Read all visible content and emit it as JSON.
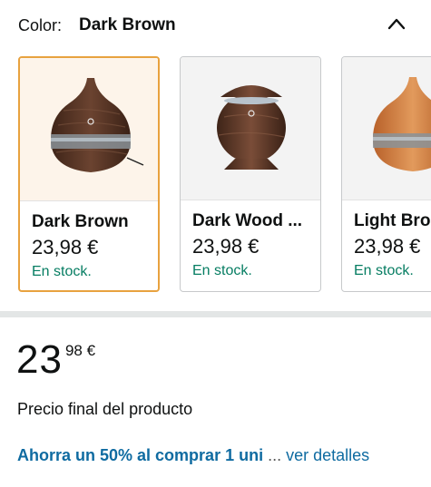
{
  "color_selector": {
    "label": "Color:",
    "selected_value": "Dark Brown",
    "toggle_icon": "chevron-up-icon"
  },
  "variants": [
    {
      "name": "Dark Brown",
      "price": "23,98 €",
      "stock": "En stock.",
      "selected": true
    },
    {
      "name": "Dark Wood ...",
      "price": "23,98 €",
      "stock": "En stock.",
      "selected": false
    },
    {
      "name": "Light Bro",
      "price": "23,98 €",
      "stock": "En stock.",
      "selected": false
    }
  ],
  "price": {
    "whole": "23",
    "fraction": "98",
    "currency": "€",
    "final_label": "Precio final del producto"
  },
  "promo": {
    "offer_text": "Ahorra un 50% al comprar 1 uni",
    "ellipsis": "...",
    "details_link": "ver detalles"
  },
  "colors": {
    "selected_border": "#e8a23f",
    "stock_green": "#067d62",
    "link_blue": "#0f6ba1"
  }
}
